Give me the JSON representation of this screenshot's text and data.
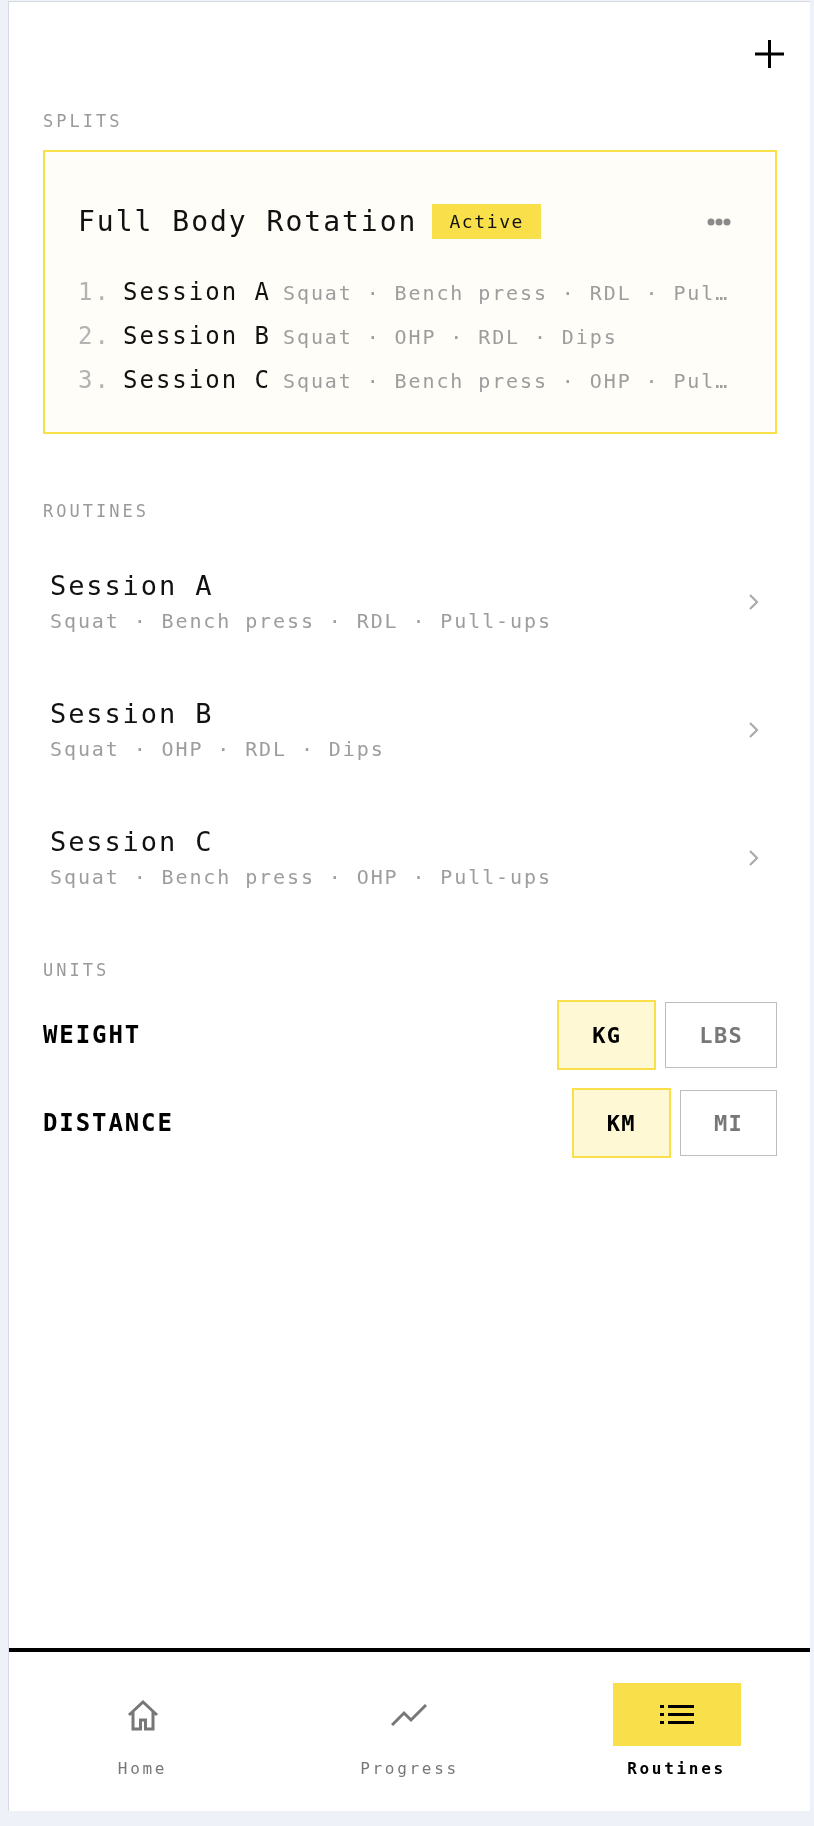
{
  "splits": {
    "heading": "SPLITS",
    "items": [
      {
        "name": "Full Body Rotation",
        "badge": "Active",
        "sessions": [
          {
            "number": "1.",
            "name": "Session A",
            "exercises": "Squat · Bench press · RDL · Pul…"
          },
          {
            "number": "2.",
            "name": "Session B",
            "exercises": "Squat · OHP · RDL · Dips"
          },
          {
            "number": "3.",
            "name": "Session C",
            "exercises": "Squat · Bench press · OHP · Pul…"
          }
        ]
      }
    ]
  },
  "routines": {
    "heading": "ROUTINES",
    "items": [
      {
        "name": "Session A",
        "exercises": "Squat · Bench press · RDL · Pull-ups"
      },
      {
        "name": "Session B",
        "exercises": "Squat · OHP · RDL · Dips"
      },
      {
        "name": "Session C",
        "exercises": "Squat · Bench press · OHP · Pull-ups"
      }
    ]
  },
  "units": {
    "heading": "UNITS",
    "settings": [
      {
        "label": "WEIGHT",
        "options": [
          {
            "label": "KG",
            "selected": true
          },
          {
            "label": "LBS",
            "selected": false
          }
        ]
      },
      {
        "label": "DISTANCE",
        "options": [
          {
            "label": "KM",
            "selected": true
          },
          {
            "label": "MI",
            "selected": false
          }
        ]
      }
    ]
  },
  "nav": [
    {
      "label": "Home",
      "selected": false
    },
    {
      "label": "Progress",
      "selected": false
    },
    {
      "label": "Routines",
      "selected": true
    }
  ]
}
